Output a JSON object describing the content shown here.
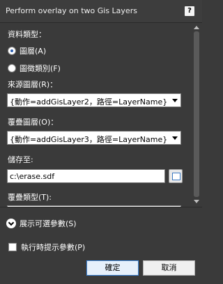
{
  "window": {
    "title": "Perform overlay on two Gis Layers",
    "help_label": "?"
  },
  "form": {
    "data_type_label": "資料類型：",
    "radio_options": [
      {
        "label": "圖層(A)",
        "checked": true
      },
      {
        "label": "圖徵類別(F)",
        "checked": false
      }
    ],
    "source_layer_label": "來源圖層(R)：",
    "source_layer_value": "{動作=addGisLayer2，路徑=LayerName}",
    "overlay_layer_label": "覆疊圖層(O)：",
    "overlay_layer_value": "{動作=addGisLayer3，路徑=LayerName}",
    "save_to_label": "儲存至:",
    "save_to_value": "c:\\erase.sdf",
    "overlay_type_label": "覆疊類型(T):"
  },
  "footer": {
    "show_optional_label": "展示可選參數(S)",
    "prompt_checkbox_label": "執行時提示參數(P)",
    "prompt_checkbox_checked": false,
    "ok_label": "確定",
    "cancel_label": "取消"
  },
  "colors": {
    "background": "#3a3a3a",
    "ok_border": "#3b84d8"
  }
}
